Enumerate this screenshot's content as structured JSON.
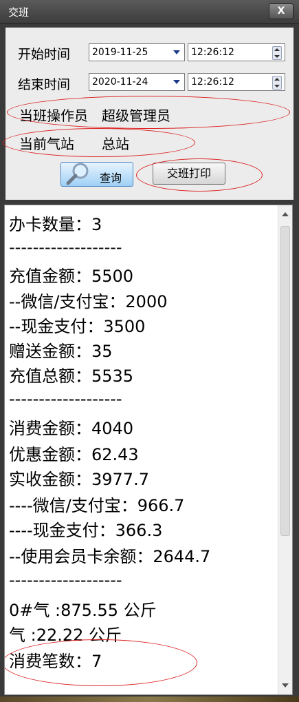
{
  "window": {
    "title": "交班",
    "close_label": "X"
  },
  "form": {
    "start_label": "开始时间",
    "start_date": "2019-11-25",
    "start_time": "12:26:12",
    "end_label": "结束时间",
    "end_date": "2020-11-24",
    "end_time": "12:26:12",
    "operator_text": "当班操作员　超级管理员",
    "station_text": "当前气站　　总站",
    "query_label": "查询",
    "print_label": "交班打印"
  },
  "report": {
    "lines": [
      "办卡数量：3",
      "-------------------",
      "充值金额：5500",
      "--微信/支付宝：2000",
      "--现金支付：3500",
      "赠送金额：35",
      "充值总额：5535",
      "-------------------",
      "消费金额：4040",
      "优惠金额：62.43",
      "实收金额：3977.7",
      "----微信/支付宝：966.7",
      "----现金支付：366.3",
      "--使用会员卡余额：2644.7",
      "-------------------",
      "0#气 :875.55 公斤",
      "气 :22.22 公斤",
      "消费笔数：7"
    ]
  },
  "colors": {
    "annotation": "#dd2222",
    "accent": "#1b3a8a"
  },
  "icons": {
    "query": "magnifier-icon",
    "close": "close-icon"
  }
}
